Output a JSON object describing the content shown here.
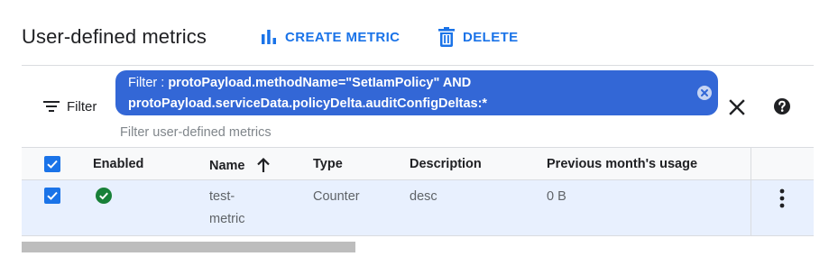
{
  "header": {
    "title": "User-defined metrics",
    "create_label": "CREATE METRIC",
    "delete_label": "DELETE",
    "create_icon": "bar-chart-icon",
    "delete_icon": "trash-icon"
  },
  "filter": {
    "button_label": "Filter",
    "chip_key": "Filter : ",
    "chip_value_line1": "protoPayload.methodName=\"SetIamPolicy\" AND",
    "chip_value_line2": "protoPayload.serviceData.policyDelta.auditConfigDeltas:*",
    "input_placeholder": "Filter user-defined metrics",
    "input_value": ""
  },
  "table": {
    "columns": [
      "",
      "Enabled",
      "Name",
      "Type",
      "Description",
      "Previous month's usage",
      ""
    ],
    "sort_column": "Name",
    "sort_direction": "ascending",
    "header_checkbox_checked": true,
    "rows": [
      {
        "selected": true,
        "enabled": true,
        "name_line1": "test-",
        "name_line2": "metric",
        "type": "Counter",
        "description": "desc",
        "usage": "0 B"
      }
    ]
  },
  "colors": {
    "accent": "#1a73e8",
    "chip": "#3367d6",
    "enabled_green": "#188038",
    "selected_row": "#e8f0fe",
    "header_row": "#f8f9fa"
  }
}
